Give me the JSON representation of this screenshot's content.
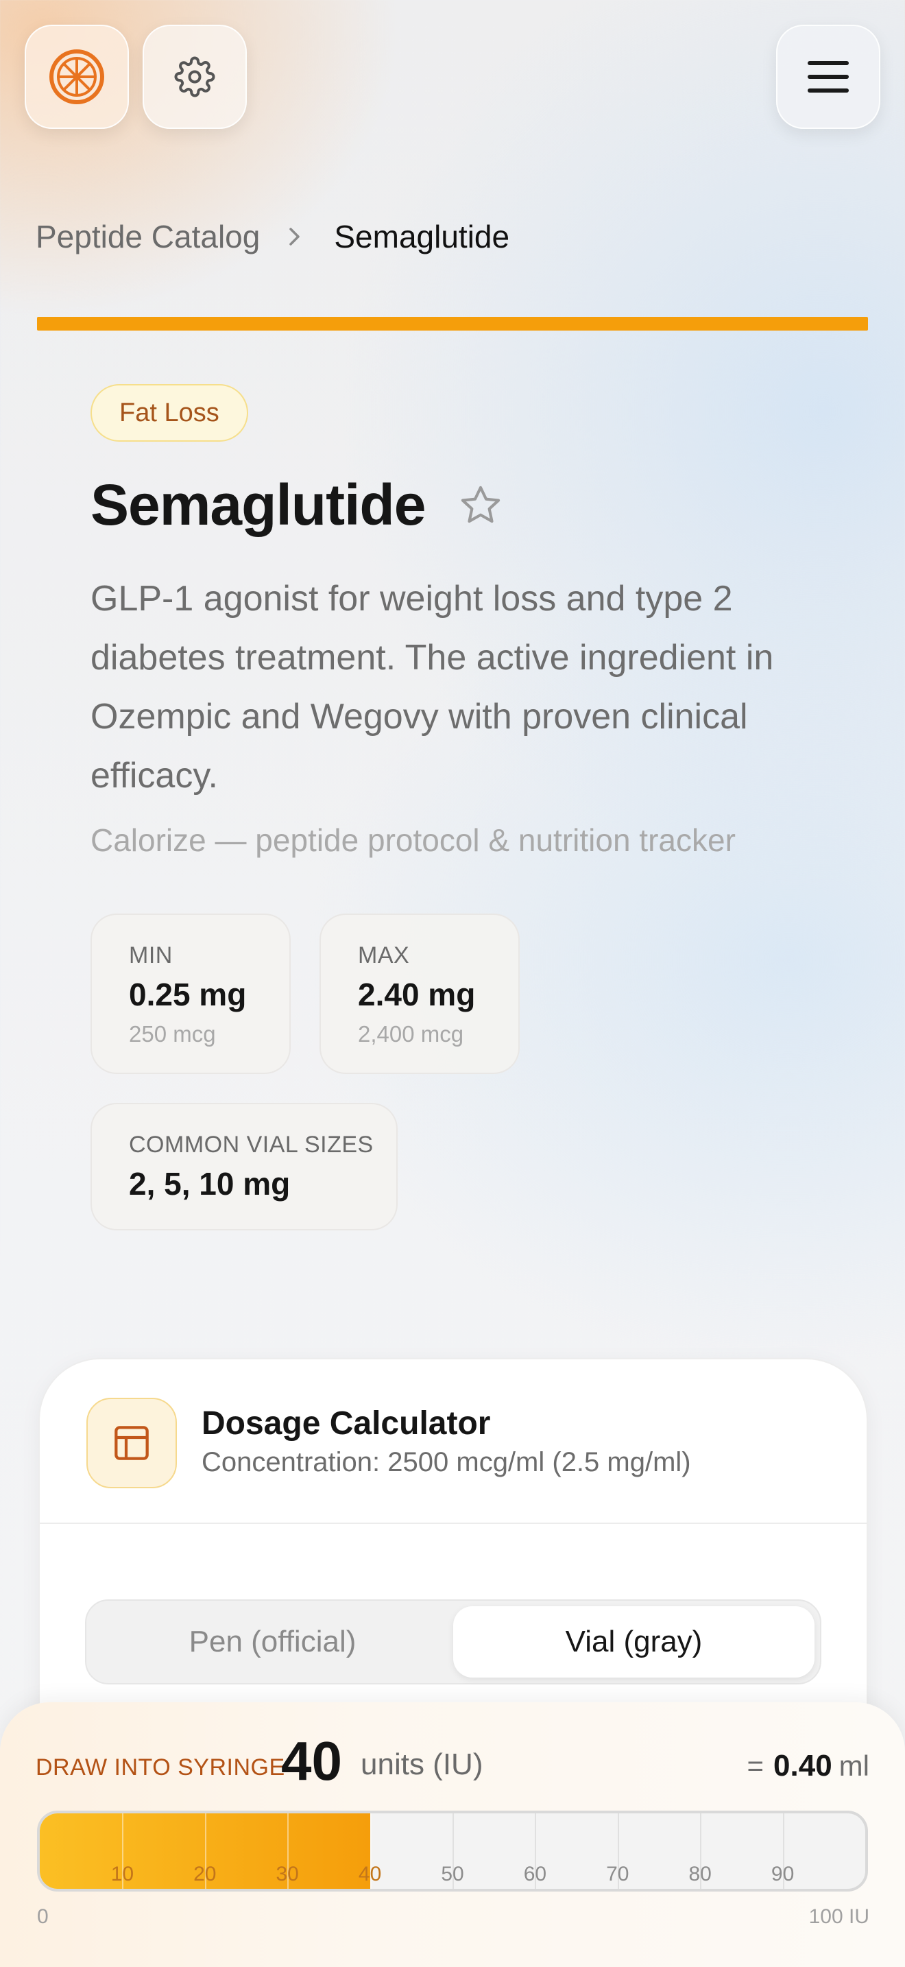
{
  "breadcrumb": {
    "parent": "Peptide Catalog",
    "current": "Semaglutide"
  },
  "peptide": {
    "category": "Fat Loss",
    "name": "Semaglutide",
    "description": "GLP-1 agonist for weight loss and type 2 diabetes treatment. The active ingredient in Ozempic and Wegovy with proven clinical efficacy.",
    "tagline": "Calorize — peptide protocol & nutrition tracker",
    "stats": {
      "min": {
        "label": "MIN",
        "value": "0.25 mg",
        "sub": "250 mcg"
      },
      "max": {
        "label": "MAX",
        "value": "2.40 mg",
        "sub": "2,400 mcg"
      },
      "vials": {
        "label": "COMMON VIAL SIZES",
        "value": "2, 5, 10 mg"
      }
    }
  },
  "calculator": {
    "title": "Dosage Calculator",
    "concentration": "Concentration: 2500 mcg/ml (2.5 mg/ml)",
    "modes": [
      "Pen (official)",
      "Vial (gray)"
    ],
    "active_mode": 1
  },
  "syringe": {
    "label": "DRAW INTO SYRINGE",
    "units": "40",
    "units_label": "units (IU)",
    "ml_prefix": "=",
    "ml_value": "0.40",
    "ml_unit": "ml",
    "fill_units": 40,
    "max_units": 100,
    "ticks": [
      "10",
      "20",
      "30",
      "40",
      "50",
      "60",
      "70",
      "80",
      "90"
    ],
    "scale_min": "0",
    "scale_max": "100 IU"
  },
  "icons": {
    "logo": "orange-slice-icon",
    "settings": "gear-icon",
    "menu": "hamburger-menu-icon",
    "favorite": "star-icon",
    "calculator": "calculator-icon",
    "breadcrumb_sep": "chevron-right-icon"
  },
  "colors": {
    "accent": "#f59e0b",
    "logo": "#e8731f",
    "badge_text": "#a5541a",
    "draw_label": "#b35215"
  }
}
